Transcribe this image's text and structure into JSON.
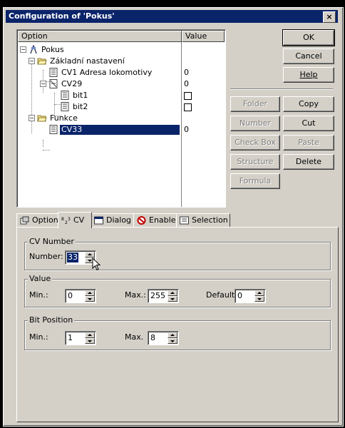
{
  "window": {
    "title": "Configuration of 'Pokus'",
    "close_glyph": "×"
  },
  "tree": {
    "columns": [
      "Option",
      "Value"
    ],
    "rows": [
      {
        "label": "Pokus",
        "value": "",
        "icon": "root-icon"
      },
      {
        "label": "Základní nastavení",
        "value": "",
        "icon": "folder-open-icon"
      },
      {
        "label": "CV1 Adresa lokomotivy",
        "value": "0",
        "icon": "cv-item-icon"
      },
      {
        "label": "CV29",
        "value": "0",
        "icon": "cv-bits-icon"
      },
      {
        "label": "bit1",
        "value": "",
        "checkbox": true,
        "icon": "cv-item-icon"
      },
      {
        "label": "bit2",
        "value": "",
        "checkbox": true,
        "icon": "cv-item-icon"
      },
      {
        "label": "Funkce",
        "value": "",
        "icon": "folder-open-icon"
      },
      {
        "label": "CV33",
        "value": "0",
        "icon": "cv-item-icon",
        "selected": true
      }
    ]
  },
  "buttons": {
    "ok": "OK",
    "cancel": "Cancel",
    "help": "Help",
    "folder": "Folder",
    "copy": "Copy",
    "number": "Number",
    "cut": "Cut",
    "checkbox": "Check Box",
    "paste": "Paste",
    "structure": "Structure",
    "delete": "Delete",
    "formula": "Formula"
  },
  "tabs": [
    "Option",
    "CV",
    "Dialog",
    "Enable",
    "Selection"
  ],
  "active_tab": "CV",
  "cv_panel": {
    "cv_number": {
      "title": "CV Number",
      "label": "Number:",
      "value": "33"
    },
    "value_group": {
      "title": "Value",
      "min_label": "Min.:",
      "min": "0",
      "max_label": "Max.:",
      "max": "255",
      "default_label": "Default:",
      "default": "0"
    },
    "bit_position": {
      "title": "Bit Position",
      "min_label": "Min.:",
      "min": "1",
      "max_label": "Max.",
      "max": "8"
    }
  },
  "colors": {
    "title_bar": "#0a246a",
    "face": "#d4d0c8",
    "selection": "#0a246a"
  }
}
